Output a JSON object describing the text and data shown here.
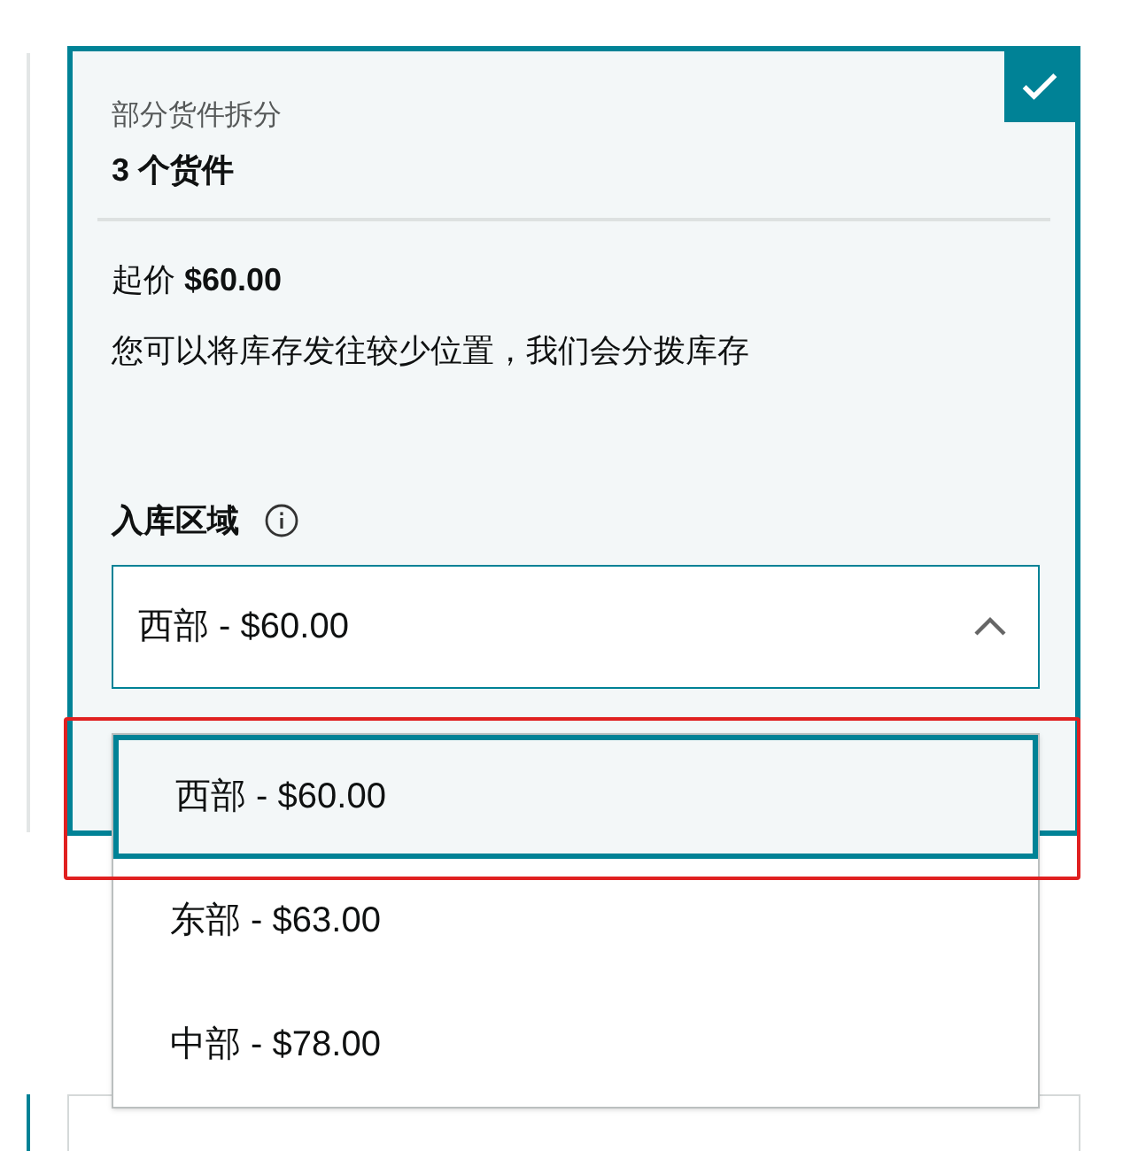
{
  "option_card": {
    "selected": true,
    "subtitle": "部分货件拆分",
    "title": "3 个货件",
    "price_label": "起价",
    "price": "$60.00",
    "description": "您可以将库存发往较少位置，我们会分拨库存",
    "field": {
      "label": "入库区域",
      "value": "西部 - $60.00",
      "expanded": true
    },
    "options": [
      {
        "label": "西部 - $60.00",
        "selected": true
      },
      {
        "label": "东部 - $63.00",
        "selected": false
      },
      {
        "label": "中部 - $78.00",
        "selected": false
      }
    ]
  }
}
